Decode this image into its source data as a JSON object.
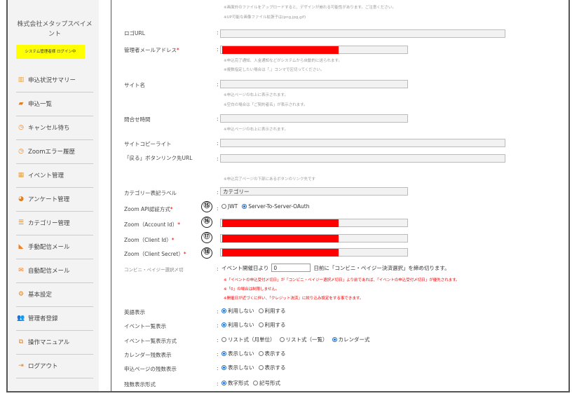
{
  "sidebar": {
    "company": "株式会社メタップスペイメント",
    "login_status": "システム管理者様 ログイン中",
    "items": [
      {
        "icon": "bar-chart-icon",
        "glyph": "▥",
        "label": "申込状況サマリー",
        "color": "#f0a030"
      },
      {
        "icon": "book-icon",
        "glyph": "▰",
        "label": "申込一覧",
        "color": "#e08020"
      },
      {
        "icon": "clock-icon",
        "glyph": "◷",
        "label": "キャンセル待ち",
        "color": "#f08020"
      },
      {
        "icon": "warning-clock-icon",
        "glyph": "◷",
        "label": "Zoomエラー履歴",
        "color": "#f08020"
      },
      {
        "icon": "grid-icon",
        "glyph": "▦",
        "label": "イベント管理",
        "color": "#f0a030"
      },
      {
        "icon": "pie-chart-icon",
        "glyph": "◕",
        "label": "アンケート管理",
        "color": "#e08020"
      },
      {
        "icon": "list-icon",
        "glyph": "☰",
        "label": "カテゴリー管理",
        "color": "#e08020"
      },
      {
        "icon": "rss-icon",
        "glyph": "◣",
        "label": "手動配信メール",
        "color": "#f08020"
      },
      {
        "icon": "mail-icon",
        "glyph": "✉",
        "label": "自動配信メール",
        "color": "#f08020"
      },
      {
        "icon": "gears-icon",
        "glyph": "⚙",
        "label": "基本設定",
        "color": "#e08020"
      },
      {
        "icon": "users-icon",
        "glyph": "👥",
        "label": "管理者登録",
        "color": "#e08020"
      },
      {
        "icon": "copy-icon",
        "glyph": "⧉",
        "label": "操作マニュアル",
        "color": "#e08020"
      },
      {
        "icon": "logout-icon",
        "glyph": "⇥",
        "label": "ログアウト",
        "color": "#e08020"
      }
    ]
  },
  "form": {
    "top_notes": [
      "※画面外のファイルをアップロードすると、デザインが崩れる可能性があります。ご注意ください。",
      "※UP可能な画像ファイル拡張子は(png,jpg,gif)"
    ],
    "logo_url": {
      "label": "ロゴURL",
      "value": ""
    },
    "admin_email": {
      "label": "管理者メールアドレス",
      "required": "*",
      "notes": [
        "※申込完了通知、入金通知などがシステムから自動的に送られます。",
        "※複数指定したい場合は「,」コンマで区切ってください。"
      ]
    },
    "site_name": {
      "label": "サイト名",
      "value": "",
      "notes": [
        "※申込ページの右上に表示されます。",
        "※空白の場合は「ご契約者名」が表示されます。"
      ]
    },
    "inquiry_hours": {
      "label": "問合せ時間",
      "value": "",
      "note": "※申込ページの右上に表示されます。"
    },
    "site_copyright": {
      "label": "サイトコピーライト",
      "value": ""
    },
    "back_link_url": {
      "label": "「戻る」ボタンリンク先URL",
      "value": "",
      "note": "※申込完了ページの下部にあるボタンのリンク先です"
    },
    "category_label": {
      "label": "カテゴリー表記ラベル",
      "value": "カテゴリー"
    },
    "zoom_auth": {
      "label": "Zoom API認証方式",
      "required": "*",
      "badge": "⑮",
      "options": [
        "JWT",
        "Server-To-Server-OAuth"
      ],
      "selected": "Server-To-Server-OAuth"
    },
    "zoom_account_id": {
      "label": "Zoom（Account Id）",
      "required": "*",
      "badge": "⑯"
    },
    "zoom_client_id": {
      "label": "Zoom（Client Id）",
      "required": "*",
      "badge": "⑰"
    },
    "zoom_client_secret": {
      "label": "Zoom（Client Secret）",
      "required": "*",
      "badge": "⑱"
    },
    "convenience_cutoff": {
      "label": "コンビニ・ペイジー選択〆切",
      "prefix": "イベント開催日より",
      "value": "0",
      "suffix": "日前に「コンビニ・ペイジー決済選択」を締め切ります。",
      "notes": [
        "※「イベントの申込受付〆切日」が「コンビニ・ペイジー選択〆切日」より前であれば、「イベントの申込受付〆切日」が優先されます。",
        "※「0」の場合は制限しません。",
        "※開催日が近づくに伴い、「クレジット決済」に絞り込み設定をする事できます。"
      ]
    },
    "english_display": {
      "label": "英語表示",
      "options": [
        "利用しない",
        "利用する"
      ],
      "selected": "利用しない"
    },
    "event_list_display": {
      "label": "イベント一覧表示",
      "options": [
        "利用しない",
        "利用する"
      ],
      "selected": "利用しない"
    },
    "event_list_mode": {
      "label": "イベント一覧表示方式",
      "options": [
        "リスト式（月単位）",
        "リスト式（一覧）",
        "カレンダー式"
      ],
      "selected": "カレンダー式"
    },
    "calendar_remaining": {
      "label": "カレンダー残数表示",
      "options": [
        "表示しない",
        "表示する"
      ],
      "selected": "表示しない"
    },
    "apply_page_remaining": {
      "label": "申込ページの残数表示",
      "options": [
        "表示しない",
        "表示する"
      ],
      "selected": "表示しない"
    },
    "remaining_format": {
      "label": "残数表示形式",
      "options": [
        "数字形式",
        "記号形式"
      ],
      "selected": "数字形式"
    }
  },
  "colors": {
    "redaction": "#ff0000",
    "accent": "#1a6fd6",
    "sidebar_bg": "#f3f3f3",
    "highlight": "#ffff00"
  }
}
